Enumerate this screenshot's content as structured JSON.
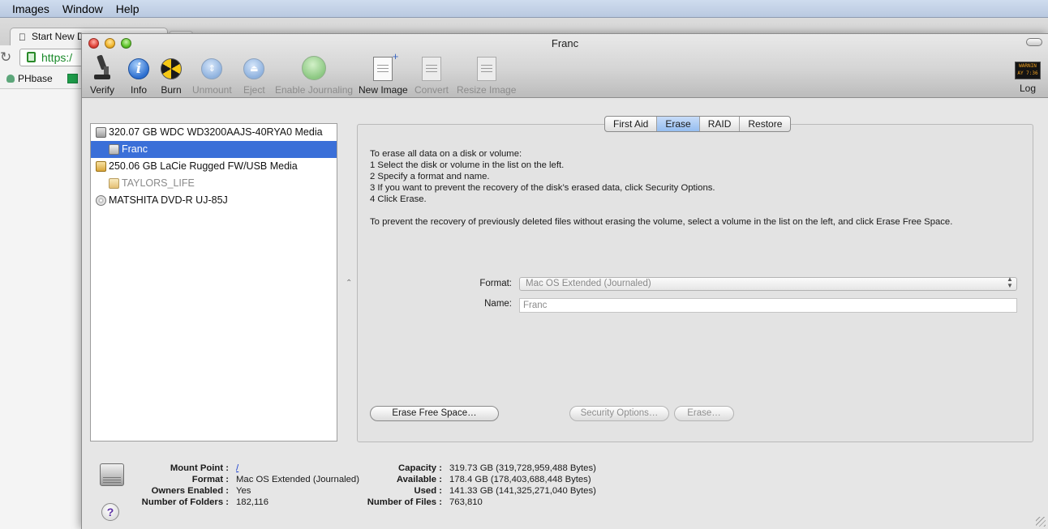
{
  "menubar": {
    "items": [
      "Images",
      "Window",
      "Help"
    ]
  },
  "browser": {
    "tab_label": "Start New D",
    "url": "https:/",
    "bookmark_label": "PHbase"
  },
  "window": {
    "title": "Franc",
    "toolbar": [
      {
        "label": "Verify",
        "icon": "microscope-icon",
        "enabled": true
      },
      {
        "label": "Info",
        "icon": "info-icon",
        "enabled": true
      },
      {
        "label": "Burn",
        "icon": "burn-icon",
        "enabled": true
      },
      {
        "label": "Unmount",
        "icon": "unmount-icon",
        "enabled": false
      },
      {
        "label": "Eject",
        "icon": "eject-icon",
        "enabled": false
      },
      {
        "label": "Enable Journaling",
        "icon": "journaling-icon",
        "enabled": false
      },
      {
        "label": "New Image",
        "icon": "new-image-icon",
        "enabled": true
      },
      {
        "label": "Convert",
        "icon": "convert-icon",
        "enabled": false
      },
      {
        "label": "Resize Image",
        "icon": "resize-image-icon",
        "enabled": false
      },
      {
        "label": "Log",
        "icon": "log-icon",
        "enabled": true
      }
    ],
    "log_icon_text": "WARNIN\nAY 7:36",
    "disks": [
      {
        "label": "320.07 GB WDC WD3200AAJS-40RYA0 Media",
        "kind": "hard-disk",
        "selected": false,
        "dimmed": false
      },
      {
        "label": "Franc",
        "kind": "volume",
        "selected": true,
        "dimmed": false
      },
      {
        "label": "250.06 GB LaCie Rugged FW/USB Media",
        "kind": "external-disk",
        "selected": false,
        "dimmed": false
      },
      {
        "label": "TAYLORS_LIFE",
        "kind": "external-volume",
        "selected": false,
        "dimmed": true
      },
      {
        "label": "MATSHITA DVD-R UJ-85J",
        "kind": "optical-drive",
        "selected": false,
        "dimmed": false
      }
    ],
    "tabs": [
      {
        "label": "First Aid",
        "active": false
      },
      {
        "label": "Erase",
        "active": true
      },
      {
        "label": "RAID",
        "active": false
      },
      {
        "label": "Restore",
        "active": false
      }
    ],
    "erase": {
      "instructions": [
        "To erase all data on a disk or volume:",
        "1 Select the disk or volume in the list on the left.",
        "2 Specify a format and name.",
        "3 If you want to prevent the recovery of the disk’s erased data, click Security Options.",
        "4 Click Erase."
      ],
      "free_space_note": "To prevent the recovery of previously deleted files without erasing the volume, select a volume in the list on the left, and click Erase Free Space.",
      "format_label": "Format:",
      "format_value": "Mac OS Extended (Journaled)",
      "name_label": "Name:",
      "name_value": "Franc",
      "buttons": {
        "erase_free_space": "Erase Free Space…",
        "security_options": "Security Options…",
        "erase": "Erase…"
      }
    },
    "info": {
      "left": [
        {
          "key": "Mount Point :",
          "value": "/",
          "link": true
        },
        {
          "key": "Format :",
          "value": "Mac OS Extended (Journaled)",
          "link": false
        },
        {
          "key": "Owners Enabled :",
          "value": "Yes",
          "link": false
        },
        {
          "key": "Number of Folders :",
          "value": "182,116",
          "link": false
        }
      ],
      "right": [
        {
          "key": "Capacity :",
          "value": "319.73 GB (319,728,959,488 Bytes)"
        },
        {
          "key": "Available :",
          "value": "178.4 GB (178,403,688,448 Bytes)"
        },
        {
          "key": "Used :",
          "value": "141.33 GB (141,325,271,040 Bytes)"
        },
        {
          "key": "Number of Files :",
          "value": "763,810"
        }
      ]
    },
    "help_glyph": "?"
  }
}
